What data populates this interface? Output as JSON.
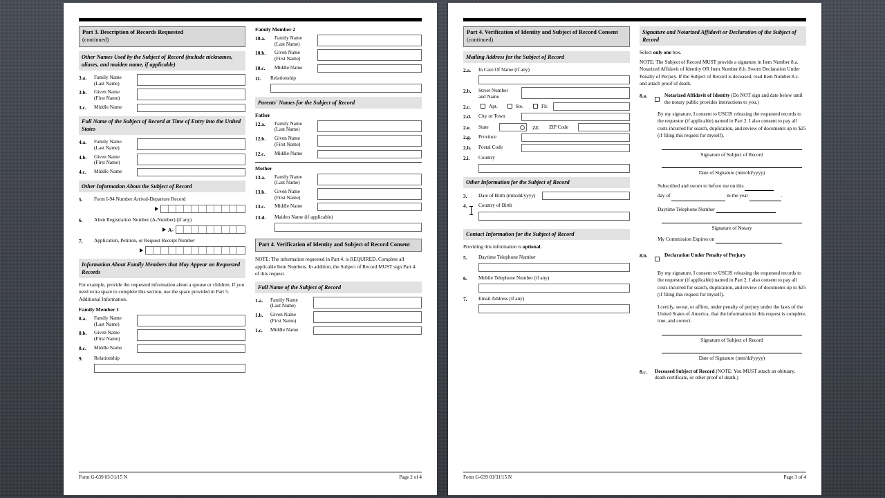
{
  "form": {
    "footer_left": "Form G-639   03/31/15   N",
    "page2_label": "Page 2 of 4",
    "page3_label": "Page 3 of 4"
  },
  "page2": {
    "col1": {
      "part3_header": "Part 3.  Description of Records Requested",
      "part3_continued": "(continued)",
      "other_names_band": "Other Names Used by the Subject of Record (include nicknames, aliases, and maiden name, if applicable)",
      "items_3": [
        {
          "num": "3.a.",
          "label": "Family Name\n(Last Name)"
        },
        {
          "num": "3.b.",
          "label": "Given Name\n(First Name)"
        },
        {
          "num": "3.c.",
          "label": "Middle Name"
        }
      ],
      "full_name_entry_band": "Full Name of the Subject of Record at Time of Entry into the United States",
      "items_4": [
        {
          "num": "4.a.",
          "label": "Family Name\n(Last Name)"
        },
        {
          "num": "4.b.",
          "label": "Given Name\n(First Name)"
        },
        {
          "num": "4.c.",
          "label": "Middle Name"
        }
      ],
      "other_info_band": "Other Information About the Subject of Record",
      "item5_num": "5.",
      "item5_label": "Form I-94 Number Arrival-Departure Record",
      "item5_cells": 11,
      "item6_num": "6.",
      "item6_label": "Alien Registration Number (A-Number) (if any)",
      "item6_prefix": "A-",
      "item6_cells": 9,
      "item7_num": "7.",
      "item7_label": "Application, Petition, or Request Receipt Number",
      "item7_cells": 13,
      "family_members_band": "Information About Family Members that May Appear on Requested Records",
      "family_note": "For example, provide the requested information about a spouse or children.  If you need extra space to complete this section, use the space provided in Part 5. Additional Information.",
      "family_member_1": "Family Member 1",
      "items_8": [
        {
          "num": "8.a.",
          "label": "Family Name\n(Last Name)"
        },
        {
          "num": "8.b.",
          "label": "Given Name\n(First Name)"
        },
        {
          "num": "8.c.",
          "label": "Middle Name"
        }
      ],
      "item9_num": "9.",
      "item9_label": "Relationship"
    },
    "col2": {
      "family_member_2": "Family Member 2",
      "items_10": [
        {
          "num": "10.a.",
          "label": "Family Name\n(Last Name)"
        },
        {
          "num": "10.b.",
          "label": "Given Name\n(First Name)"
        },
        {
          "num": "10.c.",
          "label": "Middle Name"
        }
      ],
      "item11_num": "11.",
      "item11_label": "Relationship",
      "parents_band": "Parents' Names for the Subject of Record",
      "father_label": "Father",
      "items_12": [
        {
          "num": "12.a.",
          "label": "Family Name\n(Last Name)"
        },
        {
          "num": "12.b.",
          "label": "Given Name\n(First Name)"
        },
        {
          "num": "12.c.",
          "label": "Middle Name"
        }
      ],
      "mother_label": "Mother",
      "items_13": [
        {
          "num": "13.a.",
          "label": "Family Name\n(Last Name)"
        },
        {
          "num": "13.b.",
          "label": "Given Name\n(First Name)"
        },
        {
          "num": "13.c.",
          "label": "Middle Name"
        }
      ],
      "item13d_num": "13.d.",
      "item13d_label": "Maiden Name (if applicable)",
      "part4_header": "Part 4.  Verification of Identity and Subject of Record Consent",
      "part4_note": "NOTE:  The information requested in Part 4. is REQUIRED. Complete all applicable Item Numbers.  In addition, the Subject of Record MUST sign Part 4. of this request.",
      "full_name_band": "Full Name of the Subject of Record",
      "items_1": [
        {
          "num": "1.a.",
          "label": "Family Name\n(Last Name)"
        },
        {
          "num": "1.b.",
          "label": "Given Name\n(First Name)"
        },
        {
          "num": "1.c.",
          "label": "Middle Name"
        }
      ]
    }
  },
  "page3": {
    "col1": {
      "part4_header": "Part 4.  Verification of Identity and Subject of Record Consent",
      "part4_continued": "(continued)",
      "mailing_band": "Mailing Address for the Subject of Record",
      "item2a_num": "2.a.",
      "item2a_label": "In Care Of Name (if any)",
      "item2b_num": "2.b.",
      "item2b_label": "Street Number\nand Name",
      "item2c_num": "2.c.",
      "item2c_opt1": "Apt.",
      "item2c_opt2": "Ste.",
      "item2c_opt3": "Flr.",
      "item2d_num": "2.d.",
      "item2d_label": "City or Town",
      "item2e_num": "2.e.",
      "item2e_label": "State",
      "item2f_num": "2.f.",
      "item2f_label": "ZIP Code",
      "item2g_num": "2.g.",
      "item2g_label": "Province",
      "item2h_num": "2.h.",
      "item2h_label": "Postal Code",
      "item2i_num": "2.i.",
      "item2i_label": "Country",
      "other_info_band": "Other Information for the Subject of Record",
      "item3_num": "3.",
      "item3_label": "Date of Birth   (mm/dd/yyyy)",
      "item4_num": "4.",
      "item4_label": "Country of Birth",
      "contact_band": "Contact Information for the Subject of Record",
      "contact_note_a": "Providing this information is ",
      "contact_note_b": "optional",
      "contact_note_c": ".",
      "item5_num": "5.",
      "item5_label": "Daytime Telephone Number",
      "item6_num": "6.",
      "item6_label": "Mobile Telephone Number (if any)",
      "item7_num": "7.",
      "item7_label": "Email Address (if any)"
    },
    "col2": {
      "signature_band": "Signature and Notarized Affidavit or Declaration of the Subject of Record",
      "select_one_a": "Select ",
      "select_one_b": "only one",
      "select_one_c": " box.",
      "note_text": "NOTE:  The Subject of Record MUST provide a signature in Item Number 8.a. Notarized Affidavit of Identity OR Item Number 8.b. Sworn Declaration Under Penalty of Perjury.  If the Subject of Record is deceased, read Item Number 8.c. and attach proof of death.",
      "item8a_num": "8.a.",
      "item8a_title": "Notarized Affidavit of Identity",
      "item8a_rest": " (Do NOT sign and date below until the notary public provides instructions to you.)",
      "consent_text": "By my signature, I consent to USCIS releasing the requested records to the requestor (if applicable) named in Part 2.  I also consent to pay all costs incurred for search, duplication, and review of documents up to $25 (if filing this request for myself).",
      "sig_subject_caption": "Signature of Subject of Record",
      "date_sig_caption": "Date of Signature (mm/dd/yyyy)",
      "sworn_line1_a": "Subscribed and sworn to before me on this",
      "sworn_line2_a": "day of",
      "sworn_line2_b": "in the year",
      "sworn_line2_c": ".",
      "daytime_phone_label": "Daytime Telephone Number",
      "sig_notary_caption": "Signature of Notary",
      "commission_label": "My Commission Expires on",
      "item8b_num": "8.b.",
      "item8b_title": "Declaration Under Penalty of Perjury",
      "consent_text_2": "By my signature, I consent to USCIS releasing the requested records to the requestor (if applicable) named in Part 2.  I also consent to pay all costs incurred for search, duplication, and review of documents up to $25 (if filing this request for myself).",
      "certify_text": "I certify, swear, or affirm, under penalty of perjury under the laws of the United States of America, that the information in this request is complete, true, and correct.",
      "sig_subject_caption_2": "Signature of Subject of Record",
      "date_sig_caption_2": "Date of Signature (mm/dd/yyyy)",
      "item8c_num": "8.c.",
      "item8c_title": "Deceased Subject of Record",
      "item8c_rest": " (NOTE:  You MUST attach an obituary, death certificate, or other proof of death.)"
    }
  }
}
